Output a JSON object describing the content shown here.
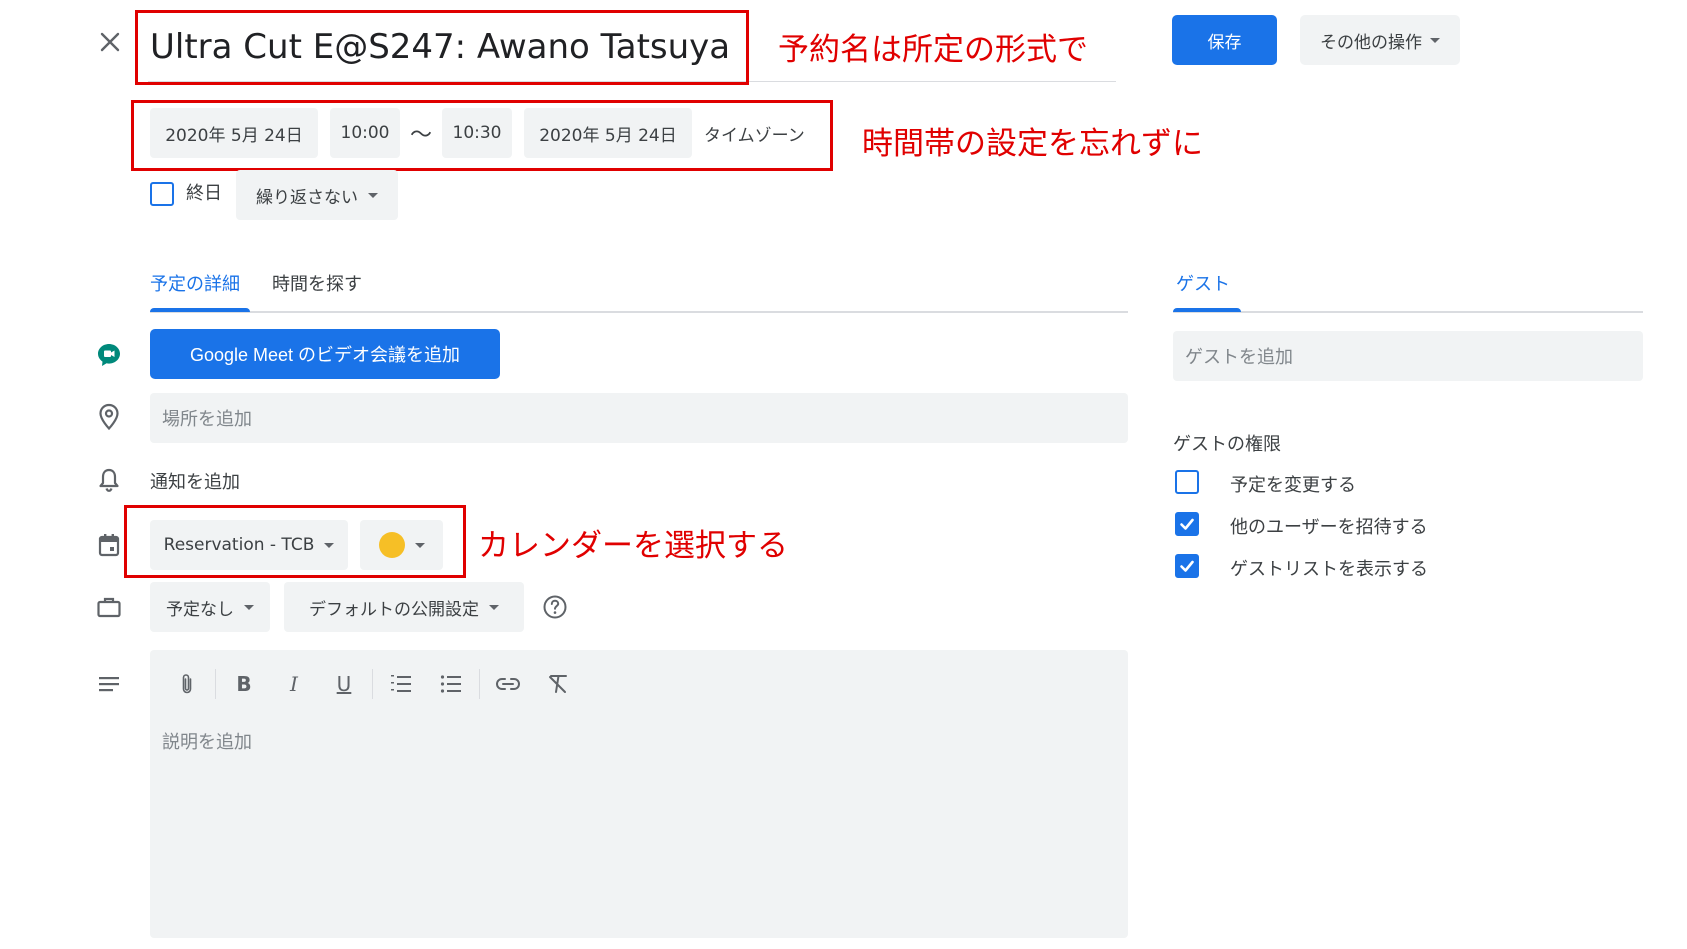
{
  "header": {
    "title_value": "Ultra Cut E@S247: Awano Tatsuya",
    "save_label": "保存",
    "more_actions_label": "その他の操作"
  },
  "time": {
    "start_date": "2020年 5月 24日",
    "start_time": "10:00",
    "separator": "〜",
    "end_time": "10:30",
    "end_date": "2020年 5月 24日",
    "timezone_label": "タイムゾーン"
  },
  "options": {
    "all_day_label": "終日",
    "repeat_label": "繰り返さない"
  },
  "tabs": [
    {
      "label": "予定の詳細"
    },
    {
      "label": "時間を探す"
    }
  ],
  "details": {
    "meet_button_label": "Google Meet のビデオ会議を追加",
    "location_placeholder": "場所を追加",
    "notification_label": "通知を追加",
    "calendar_label": "Reservation - TCB",
    "event_color": "#f6bf26",
    "busy_label": "予定なし",
    "visibility_label": "デフォルトの公開設定",
    "description_placeholder": "説明を追加"
  },
  "guests": {
    "tab_label": "ゲスト",
    "add_placeholder": "ゲストを追加",
    "permissions_title": "ゲストの権限",
    "permissions": [
      {
        "label": "予定を変更する",
        "checked": false
      },
      {
        "label": "他のユーザーを招待する",
        "checked": true
      },
      {
        "label": "ゲストリストを表示する",
        "checked": true
      }
    ]
  },
  "annotations": {
    "title_note": "予約名は所定の形式で",
    "time_note": "時間帯の設定を忘れずに",
    "calendar_note": "カレンダーを選択する"
  },
  "colors": {
    "accent": "#1a73e8",
    "annotation": "#e00000",
    "meet_icon": "#00897b"
  }
}
